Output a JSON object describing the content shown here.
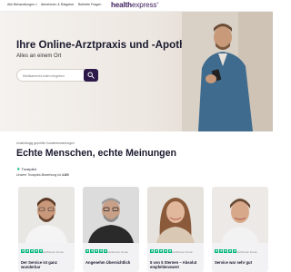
{
  "nav": {
    "items": [
      {
        "label": "Alle Behandlungen"
      },
      {
        "label": "Abnehmen & Ratgeber"
      },
      {
        "label": "Beliebte Fragen"
      }
    ],
    "logo_bold": "health",
    "logo_light": "express",
    "logo_reg": "®"
  },
  "hero": {
    "title": "Ihre Online-Arztpraxis und -Apotheke",
    "subtitle": "Alles an einem Ort",
    "search_placeholder": "Medikament/Leiden eingeben"
  },
  "reviews_section": {
    "eyebrow": "Unabhängig geprüfte Kundenbewertungen",
    "title": "Echte Menschen, echte Meinungen",
    "trustpilot_label": "Trustpilot",
    "trustpilot_rating_prefix": "Unsere Trustpilot-Bewertung ist",
    "trustpilot_rating_value": "4.6/5",
    "cards": [
      {
        "verified": "Verifizierter Kunde",
        "text": "Der Service ist ganz wunderbar",
        "rating": 5
      },
      {
        "verified": "Verifizierter Kunde",
        "text": "Angenehm Übersichtlich",
        "rating": 5
      },
      {
        "verified": "Verifizierter Kunde",
        "text": "5 von 5 Sternen – Absolut empfehlenswert",
        "rating": 5
      },
      {
        "verified": "Verifizierter Kunde",
        "text": "Service war sehr gut",
        "rating": 5
      }
    ]
  },
  "colors": {
    "brand_dark": "#2d1a4a",
    "trustpilot_green": "#00b67a",
    "hero_bg": "#f0ebe5"
  }
}
